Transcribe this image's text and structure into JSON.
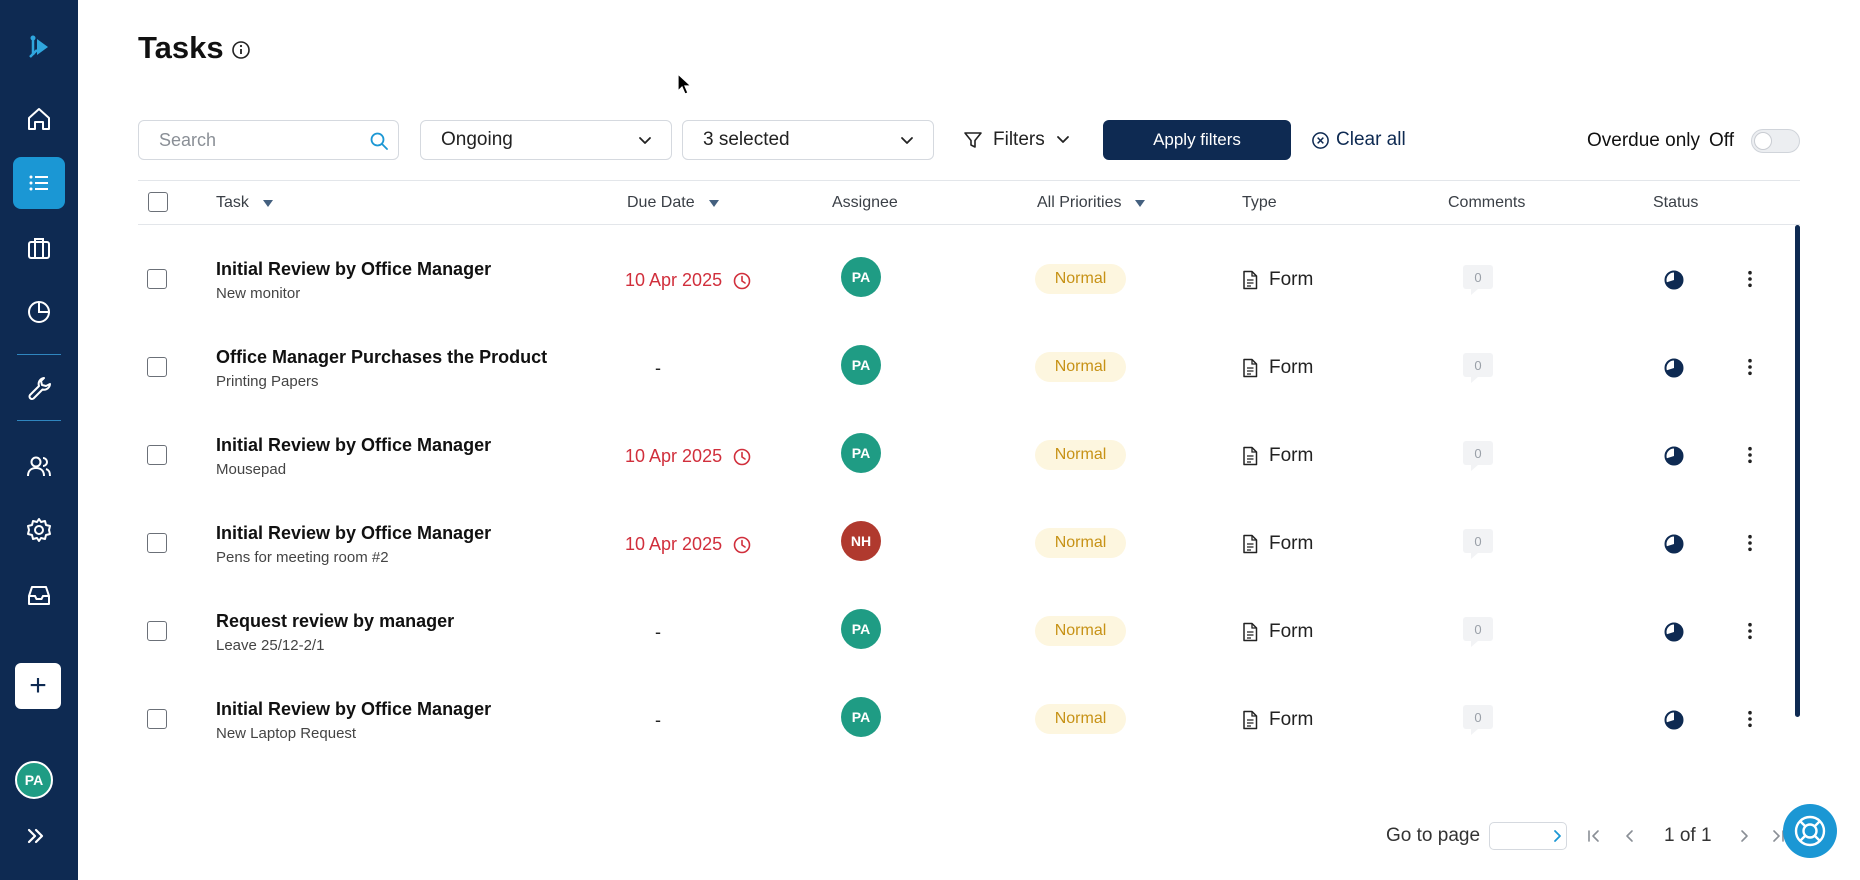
{
  "page": {
    "title": "Tasks"
  },
  "toolbar": {
    "search_placeholder": "Search",
    "status_select": "Ongoing",
    "category_select": "3 selected",
    "filters_label": "Filters",
    "apply_label": "Apply filters",
    "clear_label": "Clear all",
    "overdue_label": "Overdue only",
    "overdue_state": "Off"
  },
  "table": {
    "columns": {
      "task": "Task",
      "due": "Due Date",
      "assignee": "Assignee",
      "priority": "All Priorities",
      "type": "Type",
      "comments": "Comments",
      "status": "Status"
    },
    "rows": [
      {
        "title": "Initial Review by Office Manager",
        "sub": "New monitor",
        "due": "10 Apr 2025",
        "overdue": true,
        "assignee": "PA",
        "avatar_color": "#1f9c84",
        "priority": "Normal",
        "type": "Form",
        "comments": "0"
      },
      {
        "title": "Office Manager Purchases the Product",
        "sub": "Printing Papers",
        "due": "-",
        "overdue": false,
        "assignee": "PA",
        "avatar_color": "#1f9c84",
        "priority": "Normal",
        "type": "Form",
        "comments": "0"
      },
      {
        "title": "Initial Review by Office Manager",
        "sub": "Mousepad",
        "due": "10 Apr 2025",
        "overdue": true,
        "assignee": "PA",
        "avatar_color": "#1f9c84",
        "priority": "Normal",
        "type": "Form",
        "comments": "0"
      },
      {
        "title": "Initial Review by Office Manager",
        "sub": "Pens for meeting room #2",
        "due": "10 Apr 2025",
        "overdue": true,
        "assignee": "NH",
        "avatar_color": "#b0392e",
        "priority": "Normal",
        "type": "Form",
        "comments": "0"
      },
      {
        "title": "Request review by manager",
        "sub": "Leave 25/12-2/1",
        "due": "-",
        "overdue": false,
        "assignee": "PA",
        "avatar_color": "#1f9c84",
        "priority": "Normal",
        "type": "Form",
        "comments": "0"
      },
      {
        "title": "Initial Review by Office Manager",
        "sub": "New Laptop Request",
        "due": "-",
        "overdue": false,
        "assignee": "PA",
        "avatar_color": "#1f9c84",
        "priority": "Normal",
        "type": "Form",
        "comments": "0"
      }
    ]
  },
  "pagination": {
    "goto_label": "Go to page",
    "page_text": "1 of 1"
  },
  "user": {
    "initials": "PA"
  },
  "colors": {
    "sidebar": "#0e2a52",
    "accent": "#1b97d4",
    "overdue": "#d12f3c",
    "priority_bg": "#fdf6df",
    "priority_text": "#c79216"
  },
  "icons": {
    "sidebar": [
      "logo-icon",
      "home-icon",
      "list-icon",
      "briefcase-icon",
      "pie-chart-icon",
      "wrench-icon",
      "users-icon",
      "gear-icon",
      "inbox-icon",
      "plus-icon",
      "expand-icon"
    ]
  }
}
